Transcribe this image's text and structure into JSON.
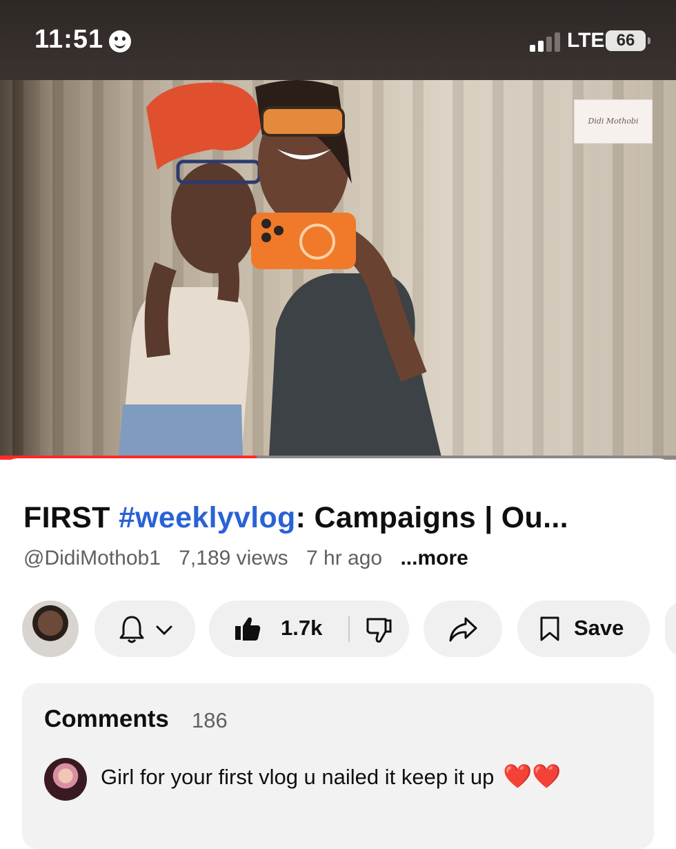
{
  "status_bar": {
    "time": "11:51",
    "network": "LTE",
    "battery": "66",
    "signal_bars_active": 2,
    "signal_bars_total": 4
  },
  "video": {
    "watermark_text": "Didi Mothobi",
    "progress_fraction": 0.38,
    "progress_color": "#ff2a2a"
  },
  "details": {
    "title_prefix": "FIRST ",
    "title_hashtag": "#weeklyvlog",
    "title_rest": ": Campaigns | Ou...",
    "channel": "@DidiMothob1",
    "views": "7,189 views",
    "age": "7 hr ago",
    "more": "...more"
  },
  "actions": {
    "like_count": "1.7k",
    "save_label": "Save",
    "icons": [
      "bell-icon",
      "chevron-down-icon",
      "thumbs-up-icon",
      "thumbs-down-icon",
      "share-icon",
      "bookmark-icon"
    ]
  },
  "comments": {
    "title": "Comments",
    "count": "186",
    "top_comment": "Girl for your first vlog u nailed it keep it up",
    "top_comment_emoji": "❤️❤️"
  },
  "colors": {
    "hashtag": "#2a62d6",
    "pill_bg": "#f0f0f0",
    "comments_bg": "#f2f2f2"
  }
}
